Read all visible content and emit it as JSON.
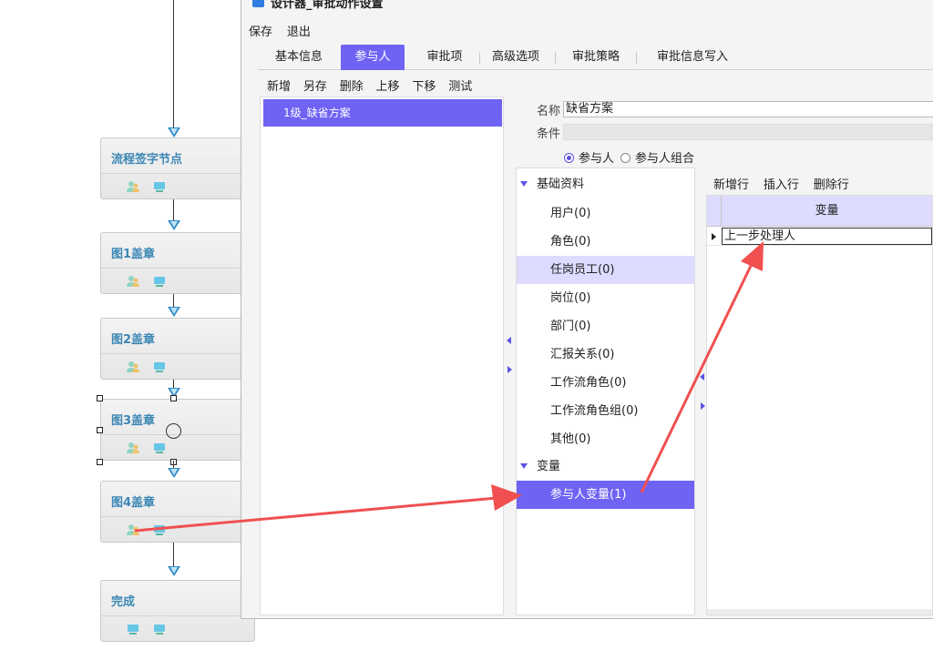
{
  "window": {
    "title": "设计器_审批动作设置"
  },
  "menu": {
    "save": "保存",
    "exit": "退出"
  },
  "tabs": [
    {
      "label": "基本信息"
    },
    {
      "label": "参与人"
    },
    {
      "label": "审批项"
    },
    {
      "label": "高级选项"
    },
    {
      "label": "审批策略"
    },
    {
      "label": "审批信息写入"
    }
  ],
  "toolbar": {
    "add": "新增",
    "save_as": "另存",
    "delete": "删除",
    "move_up": "上移",
    "move_down": "下移",
    "test": "测试"
  },
  "plans": [
    {
      "label": "1级_缺省方案"
    }
  ],
  "form": {
    "name_label": "名称",
    "name_value": "缺省方案",
    "condition_label": "条件",
    "condition_value": "",
    "radio_participant": "参与人",
    "radio_participant_group": "参与人组合"
  },
  "categories": {
    "basic_group": "基础资料",
    "basic_items": [
      {
        "label": "用户(0)"
      },
      {
        "label": "角色(0)"
      },
      {
        "label": "任岗员工(0)"
      },
      {
        "label": "岗位(0)"
      },
      {
        "label": "部门(0)"
      },
      {
        "label": "汇报关系(0)"
      },
      {
        "label": "工作流角色(0)"
      },
      {
        "label": "工作流角色组(0)"
      },
      {
        "label": "其他(0)"
      }
    ],
    "var_group": "变量",
    "var_items": [
      {
        "label": "参与人变量(1)"
      }
    ]
  },
  "var_toolbar": {
    "add_row": "新增行",
    "insert_row": "插入行",
    "delete_row": "删除行"
  },
  "grid": {
    "column": "变量",
    "rows": [
      {
        "value": "上一步处理人"
      }
    ]
  },
  "flow": {
    "nodes": [
      {
        "title": "流程签字节点"
      },
      {
        "title": "图1盖章"
      },
      {
        "title": "图2盖章"
      },
      {
        "title": "图3盖章"
      },
      {
        "title": "图4盖章"
      },
      {
        "title": "完成"
      }
    ]
  },
  "colors": {
    "accent": "#6e63f3",
    "highlight": "#dddbff",
    "annotation_arrow": "#f05050",
    "node_title": "#3c87b4"
  }
}
